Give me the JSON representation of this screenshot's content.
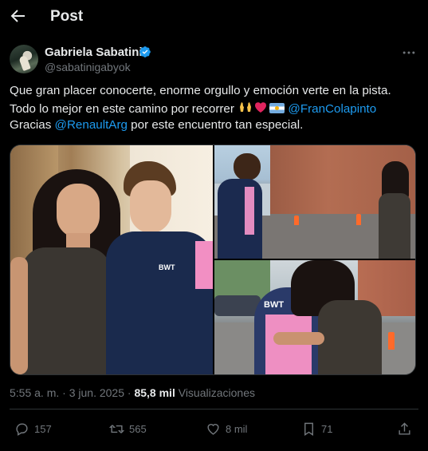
{
  "header": {
    "title": "Post"
  },
  "author": {
    "name": "Gabriela Sabatini",
    "handle": "@sabatinigabyok"
  },
  "post": {
    "line1": "Que gran placer conocerte, enorme orgullo y emoción verte en la pista.",
    "line2_prefix": "Todo lo mejor en este camino por recorrer ",
    "mention1": "@FranColapinto",
    "line3_prefix": "Gracias ",
    "mention2": "@RenaultArg",
    "line3_suffix": " por este encuentro tan especial.",
    "emojis": [
      "raising-hands-icon",
      "red-heart-icon",
      "argentina-flag-icon"
    ]
  },
  "photos": [
    {
      "alt": "photo-selfie",
      "badge_text": "BWT"
    },
    {
      "alt": "photo-walking-meeting"
    },
    {
      "alt": "photo-hug",
      "badge_text": "BWT"
    }
  ],
  "meta": {
    "time": "5:55 a. m.",
    "date": "3 jun. 2025",
    "views_count": "85,8 mil",
    "views_label": "Visualizaciones"
  },
  "actions": {
    "replies": "157",
    "reposts": "565",
    "likes": "8 mil",
    "bookmarks": "71"
  },
  "colors": {
    "accent": "#1d9bf0",
    "background": "#000000",
    "text": "#e7e9ea",
    "muted": "#71767b"
  }
}
